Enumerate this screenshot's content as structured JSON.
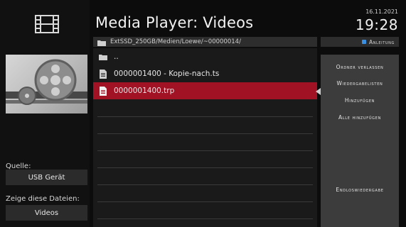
{
  "header": {
    "title": "Media Player: Videos",
    "date": "16.11.2021",
    "time": "19:28",
    "path": "ExtSSD_250GB/Medien/Loewe/~00000014/",
    "help_label": "Anleitung",
    "help_color": "#3b8fe0"
  },
  "sidebar": {
    "logo_icon": "film-strip-icon",
    "thumbnail_icon": "film-reel-icon",
    "source_label": "Quelle:",
    "source_value": "USB Gerät",
    "filter_label": "Zeige diese Dateien:",
    "filter_value": "Videos"
  },
  "files": [
    {
      "name": "..",
      "icon": "folder-icon"
    },
    {
      "name": "0000001400 - Kopie-nach.ts",
      "icon": "video-file-icon"
    },
    {
      "name": "0000001400.trp",
      "icon": "video-file-icon",
      "selected": true
    }
  ],
  "actions": {
    "exit_folder": "Ordner verlassen",
    "playlists": "Wiedergabelisten",
    "add": "Hinzufügen",
    "add_all": "Alle hinzufügen",
    "loop": "Endloswiedergabe"
  },
  "colors": {
    "selection": "#a01224",
    "accent_blue": "#3b8fe0"
  }
}
